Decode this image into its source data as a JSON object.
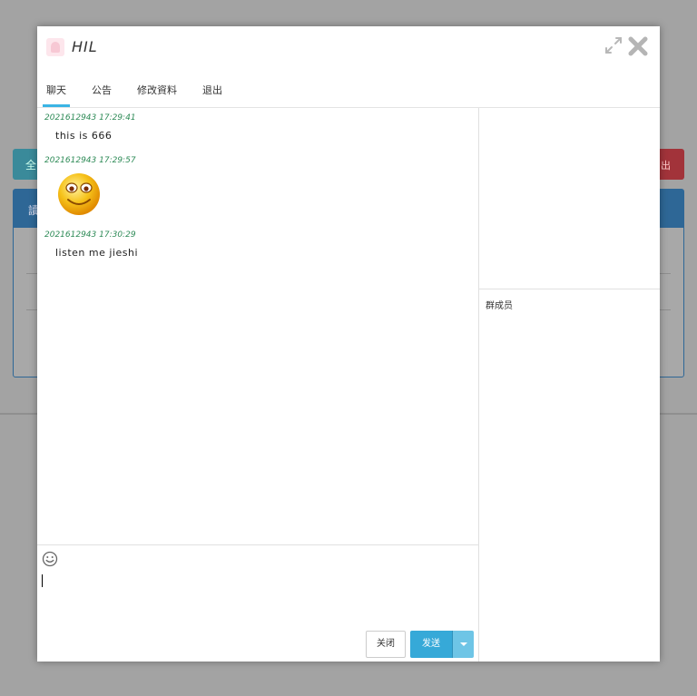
{
  "background": {
    "left_button_label": "全",
    "right_button_label": "出",
    "panel_header_label": "讀"
  },
  "window": {
    "title": "HIL",
    "tabs": [
      {
        "label": "聊天",
        "active": true
      },
      {
        "label": "公告",
        "active": false
      },
      {
        "label": "修改資料",
        "active": false
      },
      {
        "label": "退出",
        "active": false
      }
    ]
  },
  "messages": [
    {
      "time": "2021612943 17:29:41",
      "text": "this is 666"
    },
    {
      "time": "2021612943 17:29:57",
      "emoji": "smiley-face"
    },
    {
      "time": "2021612943 17:30:29",
      "text": "listen me jieshi"
    }
  ],
  "input": {
    "close_label": "关闭",
    "send_label": "发送"
  },
  "sidebar": {
    "members_label": "群成员"
  },
  "colors": {
    "accent": "#36a9d8",
    "timestamp": "#2e8b57",
    "emoji_fill": "#f6c21a"
  }
}
